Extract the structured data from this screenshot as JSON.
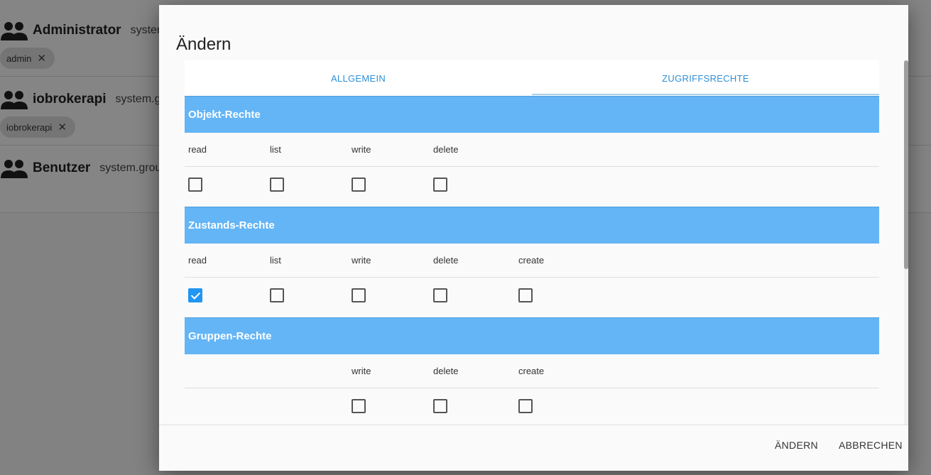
{
  "background": {
    "groups": [
      {
        "name": "Administrator",
        "id": "syster",
        "chip": "admin"
      },
      {
        "name": "iobrokerapi",
        "id": "system.g",
        "chip": "iobrokerapi"
      },
      {
        "name": "Benutzer",
        "id": "system.grou",
        "chip": ""
      }
    ],
    "icons": {
      "group": "group-icon",
      "chip_remove": "close-icon"
    }
  },
  "dialog": {
    "title": "Ändern",
    "tabs": [
      {
        "label": "ALLGEMEIN",
        "active": false
      },
      {
        "label": "ZUGRIFFSRECHTE",
        "active": true
      }
    ],
    "sections": [
      {
        "title": "Objekt-Rechte",
        "permissions": [
          {
            "label": "read",
            "checked": false
          },
          {
            "label": "list",
            "checked": false
          },
          {
            "label": "write",
            "checked": false
          },
          {
            "label": "delete",
            "checked": false
          }
        ]
      },
      {
        "title": "Zustands-Rechte",
        "permissions": [
          {
            "label": "read",
            "checked": true
          },
          {
            "label": "list",
            "checked": false
          },
          {
            "label": "write",
            "checked": false
          },
          {
            "label": "delete",
            "checked": false
          },
          {
            "label": "create",
            "checked": false
          }
        ]
      },
      {
        "title": "Gruppen-Rechte",
        "permissions": [
          {
            "label": "write",
            "checked": false
          },
          {
            "label": "delete",
            "checked": false
          },
          {
            "label": "create",
            "checked": false
          }
        ]
      }
    ],
    "footer": {
      "confirm_label": "ÄNDERN",
      "cancel_label": "ABBRECHEN"
    }
  },
  "colors": {
    "accent": "#2196f3",
    "section_header": "#64b5f6",
    "tab_text": "#2e8fd6"
  }
}
